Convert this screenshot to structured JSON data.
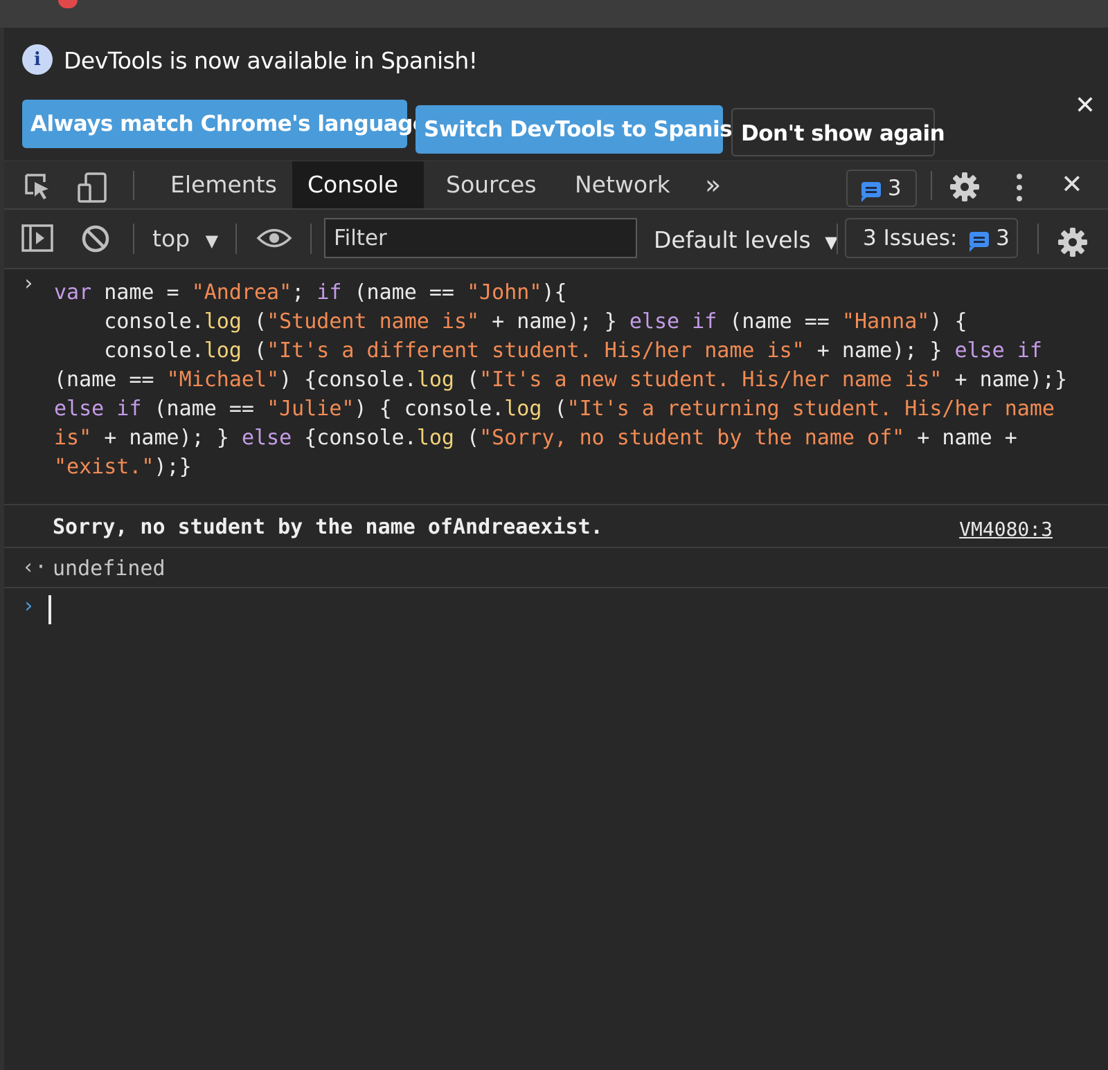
{
  "infobar": {
    "message": "DevTools is now available in Spanish!",
    "buttons": [
      "Always match Chrome's language",
      "Switch DevTools to Spanish",
      "Don't show again"
    ],
    "close": "✕"
  },
  "toolbar": {
    "tabs": [
      "Elements",
      "Console",
      "Sources",
      "Network"
    ],
    "more": "»",
    "message_count": "3",
    "close": "✕"
  },
  "console_toolbar": {
    "context": "top",
    "filter_placeholder": "Filter",
    "levels": "Default levels",
    "issues_label": "3 Issues:",
    "issues_count": "3"
  },
  "console": {
    "input_prompt": "›",
    "code": [
      [
        "kw",
        "var"
      ],
      [
        "pl",
        " name = "
      ],
      [
        "str",
        "\"Andrea\""
      ],
      [
        "pl",
        "; "
      ],
      [
        "kw",
        "if"
      ],
      [
        "pl",
        " (name == "
      ],
      [
        "str",
        "\"John\""
      ],
      [
        "pl",
        "){\n    console."
      ],
      [
        "fn",
        "log"
      ],
      [
        "pl",
        " ("
      ],
      [
        "str",
        "\"Student name is\""
      ],
      [
        "pl",
        " + name); } "
      ],
      [
        "kw",
        "else if"
      ],
      [
        "pl",
        " (name == "
      ],
      [
        "str",
        "\"Hanna\""
      ],
      [
        "pl",
        ") {\n    console."
      ],
      [
        "fn",
        "log"
      ],
      [
        "pl",
        " ("
      ],
      [
        "str",
        "\"It's a different student. His/her name is\""
      ],
      [
        "pl",
        " + name); } "
      ],
      [
        "kw",
        "else if"
      ],
      [
        "pl",
        " (name == "
      ],
      [
        "str",
        "\"Michael\""
      ],
      [
        "pl",
        ") {console."
      ],
      [
        "fn",
        "log"
      ],
      [
        "pl",
        " ("
      ],
      [
        "str",
        "\"It's a new student. His/her name is\""
      ],
      [
        "pl",
        " + name);} "
      ],
      [
        "kw",
        "else if"
      ],
      [
        "pl",
        " (name == "
      ],
      [
        "str",
        "\"Julie\""
      ],
      [
        "pl",
        ") { console."
      ],
      [
        "fn",
        "log"
      ],
      [
        "pl",
        " ("
      ],
      [
        "str",
        "\"It's a returning student. His/her name is\""
      ],
      [
        "pl",
        " + name); } "
      ],
      [
        "kw",
        "else"
      ],
      [
        "pl",
        " {console."
      ],
      [
        "fn",
        "log"
      ],
      [
        "pl",
        " ("
      ],
      [
        "str",
        "\"Sorry, no student by the name of\""
      ],
      [
        "pl",
        " + name + "
      ],
      [
        "str",
        "\"exist.\""
      ],
      [
        "pl",
        ");}"
      ]
    ],
    "log_output": "Sorry, no student by the name ofAndreaexist.",
    "log_source": "VM4080:3",
    "result_prompt": "‹·",
    "result": "undefined",
    "empty_prompt": "›"
  },
  "colors": {
    "keyword": "#c59ce8",
    "string": "#f28b54",
    "function": "#f2d27a",
    "primary_button": "#4a9bd9",
    "message_badge": "#3f8cf2"
  },
  "icons": [
    "info-icon",
    "inspect-element-icon",
    "device-toggle-icon",
    "more-tabs-icon",
    "messages-icon",
    "gear-icon",
    "kebab-menu-icon",
    "close-icon",
    "sidebar-toggle-icon",
    "clear-console-icon",
    "dropdown-arrow-icon",
    "eye-icon"
  ]
}
